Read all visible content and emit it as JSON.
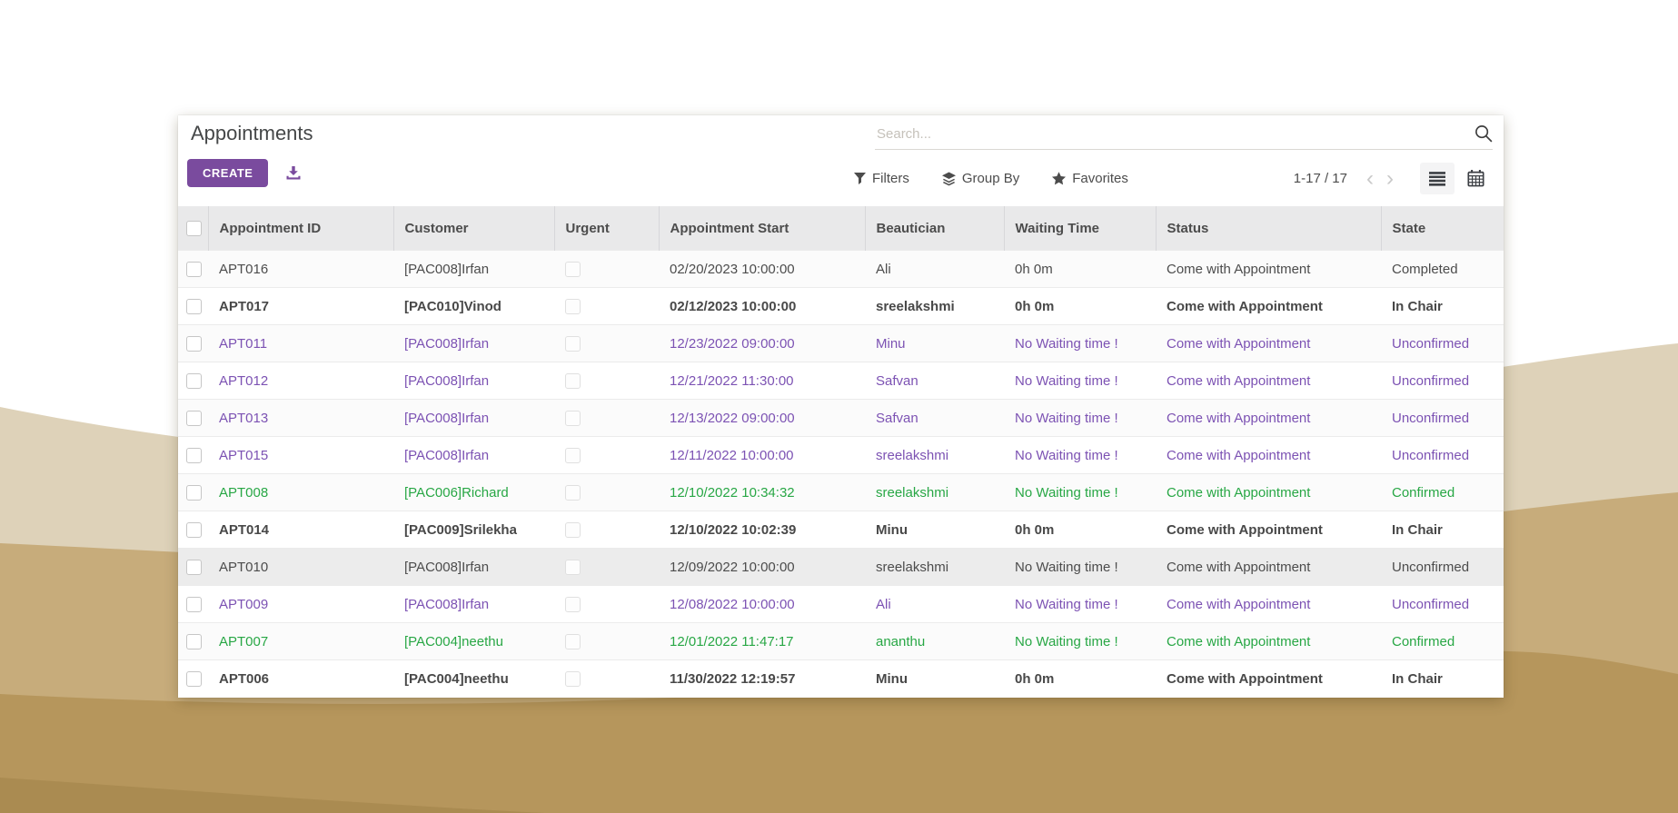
{
  "app": {
    "title": "Appointments"
  },
  "actions": {
    "create_label": "CREATE"
  },
  "search": {
    "placeholder": "Search..."
  },
  "menus": {
    "filters": "Filters",
    "group_by": "Group By",
    "favorites": "Favorites"
  },
  "pager": {
    "range": "1-17 / 17"
  },
  "view_switcher": {
    "active": "list",
    "views": [
      "list",
      "calendar"
    ]
  },
  "table": {
    "headers": [
      "Appointment ID",
      "Customer",
      "Urgent",
      "Appointment Start",
      "Beautician",
      "Waiting Time",
      "Status",
      "State"
    ],
    "rows": [
      {
        "id": "APT016",
        "customer": "[PAC008]Irfan",
        "urgent": false,
        "start": "02/20/2023 10:00:00",
        "beautician": "Ali",
        "waiting": "0h 0m",
        "status": "Come with Appointment",
        "state": "Completed",
        "decoration": "plain",
        "highlighted": false
      },
      {
        "id": "APT017",
        "customer": "[PAC010]Vinod",
        "urgent": false,
        "start": "02/12/2023 10:00:00",
        "beautician": "sreelakshmi",
        "waiting": "0h 0m",
        "status": "Come with Appointment",
        "state": "In Chair",
        "decoration": "bold",
        "highlighted": false
      },
      {
        "id": "APT011",
        "customer": "[PAC008]Irfan",
        "urgent": false,
        "start": "12/23/2022 09:00:00",
        "beautician": "Minu",
        "waiting": "No Waiting time !",
        "status": "Come with Appointment",
        "state": "Unconfirmed",
        "decoration": "purple",
        "highlighted": false
      },
      {
        "id": "APT012",
        "customer": "[PAC008]Irfan",
        "urgent": false,
        "start": "12/21/2022 11:30:00",
        "beautician": "Safvan",
        "waiting": "No Waiting time !",
        "status": "Come with Appointment",
        "state": "Unconfirmed",
        "decoration": "purple",
        "highlighted": false
      },
      {
        "id": "APT013",
        "customer": "[PAC008]Irfan",
        "urgent": false,
        "start": "12/13/2022 09:00:00",
        "beautician": "Safvan",
        "waiting": "No Waiting time !",
        "status": "Come with Appointment",
        "state": "Unconfirmed",
        "decoration": "purple",
        "highlighted": false
      },
      {
        "id": "APT015",
        "customer": "[PAC008]Irfan",
        "urgent": false,
        "start": "12/11/2022 10:00:00",
        "beautician": "sreelakshmi",
        "waiting": "No Waiting time !",
        "status": "Come with Appointment",
        "state": "Unconfirmed",
        "decoration": "purple",
        "highlighted": false
      },
      {
        "id": "APT008",
        "customer": "[PAC006]Richard",
        "urgent": false,
        "start": "12/10/2022 10:34:32",
        "beautician": "sreelakshmi",
        "waiting": "No Waiting time !",
        "status": "Come with Appointment",
        "state": "Confirmed",
        "decoration": "green",
        "highlighted": false
      },
      {
        "id": "APT014",
        "customer": "[PAC009]Srilekha",
        "urgent": false,
        "start": "12/10/2022 10:02:39",
        "beautician": "Minu",
        "waiting": "0h 0m",
        "status": "Come with Appointment",
        "state": "In Chair",
        "decoration": "bold",
        "highlighted": false
      },
      {
        "id": "APT010",
        "customer": "[PAC008]Irfan",
        "urgent": false,
        "start": "12/09/2022 10:00:00",
        "beautician": "sreelakshmi",
        "waiting": "No Waiting time !",
        "status": "Come with Appointment",
        "state": "Unconfirmed",
        "decoration": "plain",
        "highlighted": true
      },
      {
        "id": "APT009",
        "customer": "[PAC008]Irfan",
        "urgent": false,
        "start": "12/08/2022 10:00:00",
        "beautician": "Ali",
        "waiting": "No Waiting time !",
        "status": "Come with Appointment",
        "state": "Unconfirmed",
        "decoration": "purple",
        "highlighted": false
      },
      {
        "id": "APT007",
        "customer": "[PAC004]neethu",
        "urgent": false,
        "start": "12/01/2022 11:47:17",
        "beautician": "ananthu",
        "waiting": "No Waiting time !",
        "status": "Come with Appointment",
        "state": "Confirmed",
        "decoration": "green",
        "highlighted": false
      },
      {
        "id": "APT006",
        "customer": "[PAC004]neethu",
        "urgent": false,
        "start": "11/30/2022 12:19:57",
        "beautician": "Minu",
        "waiting": "0h 0m",
        "status": "Come with Appointment",
        "state": "In Chair",
        "decoration": "bold",
        "highlighted": false
      }
    ]
  },
  "colors": {
    "primary": "#7a4b9e",
    "decoration_purple": "#7c52b3",
    "decoration_green": "#28a745",
    "text": "#4c4c4c",
    "chevron": "#c9c9c9",
    "dune_light": "#ded2b9",
    "dune_mid": "#c7ac7b",
    "dune_dark": "#b6965c",
    "dune_deep": "#aa8b51"
  }
}
